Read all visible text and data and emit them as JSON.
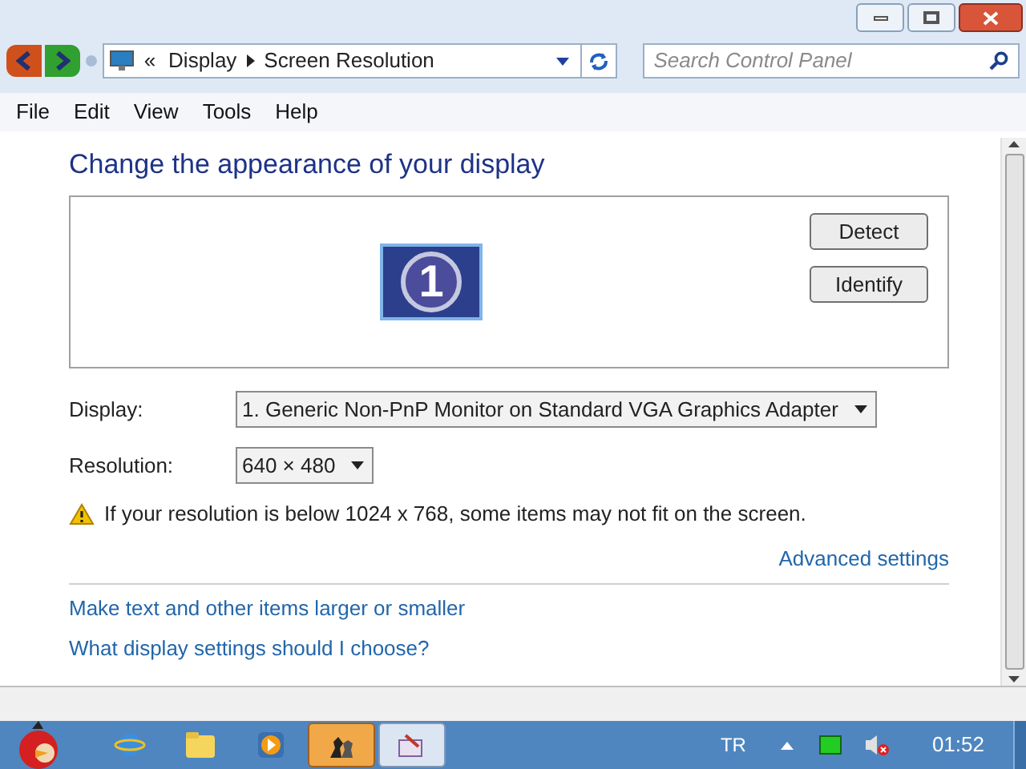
{
  "breadcrumb": {
    "separator": "«",
    "items": [
      "Display",
      "Screen Resolution"
    ]
  },
  "search": {
    "placeholder": "Search Control Panel"
  },
  "menu": [
    "File",
    "Edit",
    "View",
    "Tools",
    "Help"
  ],
  "heading": "Change the appearance of your display",
  "monitor": {
    "number": "1"
  },
  "buttons": [
    "Detect",
    "Identify"
  ],
  "fields": [
    {
      "label": "Display:",
      "value": "1. Generic Non-PnP Monitor on Standard VGA Graphics Adapter"
    },
    {
      "label": "Resolution:",
      "value": "640 × 480"
    }
  ],
  "warning": "If your resolution is below 1024 x 768, some items may not fit on the screen.",
  "advanced_link": "Advanced settings",
  "links": [
    "Make text and other items larger or smaller",
    "What display settings should I choose?"
  ],
  "taskbar": {
    "items": [
      {
        "kind": "browser",
        "selected": false
      },
      {
        "kind": "folder",
        "selected": false
      },
      {
        "kind": "media",
        "selected": false
      },
      {
        "kind": "chess",
        "selected": true
      },
      {
        "kind": "paint",
        "selected": false
      }
    ],
    "language": "TR",
    "time": "01:52"
  }
}
